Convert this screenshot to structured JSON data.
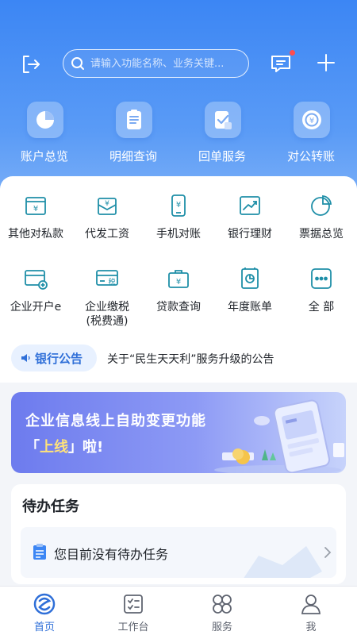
{
  "header": {
    "search_placeholder": "请输入功能名称、业务关键...",
    "icons": [
      "exit-icon",
      "search-icon",
      "message-icon",
      "plus-icon"
    ]
  },
  "quick_actions": [
    {
      "label": "账户总览",
      "icon": "pie-chart-icon"
    },
    {
      "label": "明细查询",
      "icon": "document-list-icon"
    },
    {
      "label": "回单服务",
      "icon": "receipt-check-icon"
    },
    {
      "label": "对公转账",
      "icon": "transfer-coin-icon"
    }
  ],
  "grid": [
    {
      "label": "其他对私款",
      "icon": "wallet-yen-icon"
    },
    {
      "label": "代发工资",
      "icon": "salary-envelope-icon"
    },
    {
      "label": "手机对账",
      "icon": "phone-yen-icon"
    },
    {
      "label": "银行理财",
      "icon": "trend-chart-icon"
    },
    {
      "label": "票据总览",
      "icon": "pie-chart-icon"
    },
    {
      "label": "企业开户e",
      "icon": "card-plus-icon"
    },
    {
      "label": "企业缴税",
      "label2": "(税费通)",
      "icon": "card-tax-icon"
    },
    {
      "label": "贷款查询",
      "icon": "briefcase-yen-icon"
    },
    {
      "label": "年度账单",
      "icon": "bill-chart-icon"
    },
    {
      "label": "全 部",
      "icon": "more-dots-icon"
    }
  ],
  "notice": {
    "badge": "银行公告",
    "text": "关于“民生天天利”服务升级的公告"
  },
  "banner": {
    "title": "企业信息线上自助变更功能",
    "sub_open": "「",
    "sub_highlight": "上线",
    "sub_close": "」啦!"
  },
  "todo": {
    "title": "待办任务",
    "empty_text": "您目前没有待办任务"
  },
  "tabs": [
    {
      "label": "首页",
      "icon": "home-logo-icon",
      "active": true
    },
    {
      "label": "工作台",
      "icon": "workbench-icon",
      "active": false
    },
    {
      "label": "服务",
      "icon": "service-grid-icon",
      "active": false
    },
    {
      "label": "我",
      "icon": "user-icon",
      "active": false
    }
  ],
  "colors": {
    "primary": "#3c86f4",
    "accent_blue": "#2f6fd8",
    "icon_teal": "#1f8fa8",
    "badge_red": "#ff4d4f"
  }
}
